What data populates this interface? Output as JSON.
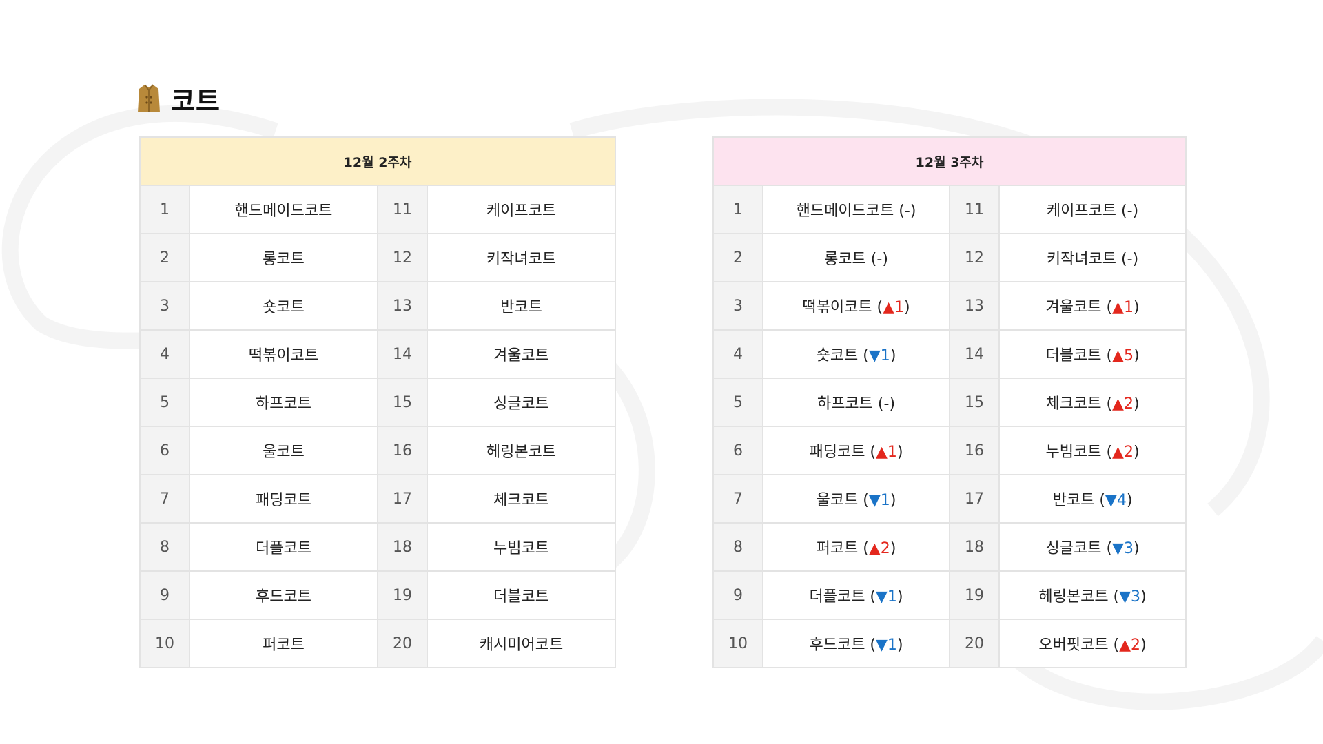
{
  "header": {
    "icon": "coat-icon",
    "title": "코트"
  },
  "week2": {
    "title": "12월 2주차",
    "rows": [
      {
        "rank_a": "1",
        "name_a": "핸드메이드코트",
        "rank_b": "11",
        "name_b": "케이프코트"
      },
      {
        "rank_a": "2",
        "name_a": "롱코트",
        "rank_b": "12",
        "name_b": "키작녀코트"
      },
      {
        "rank_a": "3",
        "name_a": "숏코트",
        "rank_b": "13",
        "name_b": "반코트"
      },
      {
        "rank_a": "4",
        "name_a": "떡볶이코트",
        "rank_b": "14",
        "name_b": "겨울코트"
      },
      {
        "rank_a": "5",
        "name_a": "하프코트",
        "rank_b": "15",
        "name_b": "싱글코트"
      },
      {
        "rank_a": "6",
        "name_a": "울코트",
        "rank_b": "16",
        "name_b": "헤링본코트"
      },
      {
        "rank_a": "7",
        "name_a": "패딩코트",
        "rank_b": "17",
        "name_b": "체크코트"
      },
      {
        "rank_a": "8",
        "name_a": "더플코트",
        "rank_b": "18",
        "name_b": "누빔코트"
      },
      {
        "rank_a": "9",
        "name_a": "후드코트",
        "rank_b": "19",
        "name_b": "더블코트"
      },
      {
        "rank_a": "10",
        "name_a": "퍼코트",
        "rank_b": "20",
        "name_b": "캐시미어코트"
      }
    ]
  },
  "week3": {
    "title": "12월 3주차",
    "rows": [
      {
        "rank_a": "1",
        "name_a": "핸드메이드코트",
        "chg_a": "-",
        "dir_a": "none",
        "rank_b": "11",
        "name_b": "케이프코트",
        "chg_b": "-",
        "dir_b": "none"
      },
      {
        "rank_a": "2",
        "name_a": "롱코트",
        "chg_a": "-",
        "dir_a": "none",
        "rank_b": "12",
        "name_b": "키작녀코트",
        "chg_b": "-",
        "dir_b": "none"
      },
      {
        "rank_a": "3",
        "name_a": "떡볶이코트",
        "chg_a": "▲1",
        "dir_a": "up",
        "rank_b": "13",
        "name_b": "겨울코트",
        "chg_b": "▲1",
        "dir_b": "up"
      },
      {
        "rank_a": "4",
        "name_a": "숏코트",
        "chg_a": "▼1",
        "dir_a": "down",
        "rank_b": "14",
        "name_b": "더블코트",
        "chg_b": "▲5",
        "dir_b": "up"
      },
      {
        "rank_a": "5",
        "name_a": "하프코트",
        "chg_a": "-",
        "dir_a": "none",
        "rank_b": "15",
        "name_b": "체크코트",
        "chg_b": "▲2",
        "dir_b": "up"
      },
      {
        "rank_a": "6",
        "name_a": "패딩코트",
        "chg_a": "▲1",
        "dir_a": "up",
        "rank_b": "16",
        "name_b": "누빔코트",
        "chg_b": "▲2",
        "dir_b": "up"
      },
      {
        "rank_a": "7",
        "name_a": "울코트",
        "chg_a": "▼1",
        "dir_a": "down",
        "rank_b": "17",
        "name_b": "반코트",
        "chg_b": "▼4",
        "dir_b": "down"
      },
      {
        "rank_a": "8",
        "name_a": "퍼코트",
        "chg_a": "▲2",
        "dir_a": "up",
        "rank_b": "18",
        "name_b": "싱글코트",
        "chg_b": "▼3",
        "dir_b": "down"
      },
      {
        "rank_a": "9",
        "name_a": "더플코트",
        "chg_a": "▼1",
        "dir_a": "down",
        "rank_b": "19",
        "name_b": "헤링본코트",
        "chg_b": "▼3",
        "dir_b": "down"
      },
      {
        "rank_a": "10",
        "name_a": "후드코트",
        "chg_a": "▼1",
        "dir_a": "down",
        "rank_b": "20",
        "name_b": "오버핏코트",
        "chg_b": "▲2",
        "dir_b": "up"
      }
    ]
  },
  "colors": {
    "week2_header_bg": "#fdf0c8",
    "week3_header_bg": "#fde3ef",
    "rank_cell_bg": "#f3f3f3",
    "up": "#e3271d",
    "down": "#1a73c7",
    "icon": "#b8893a"
  }
}
